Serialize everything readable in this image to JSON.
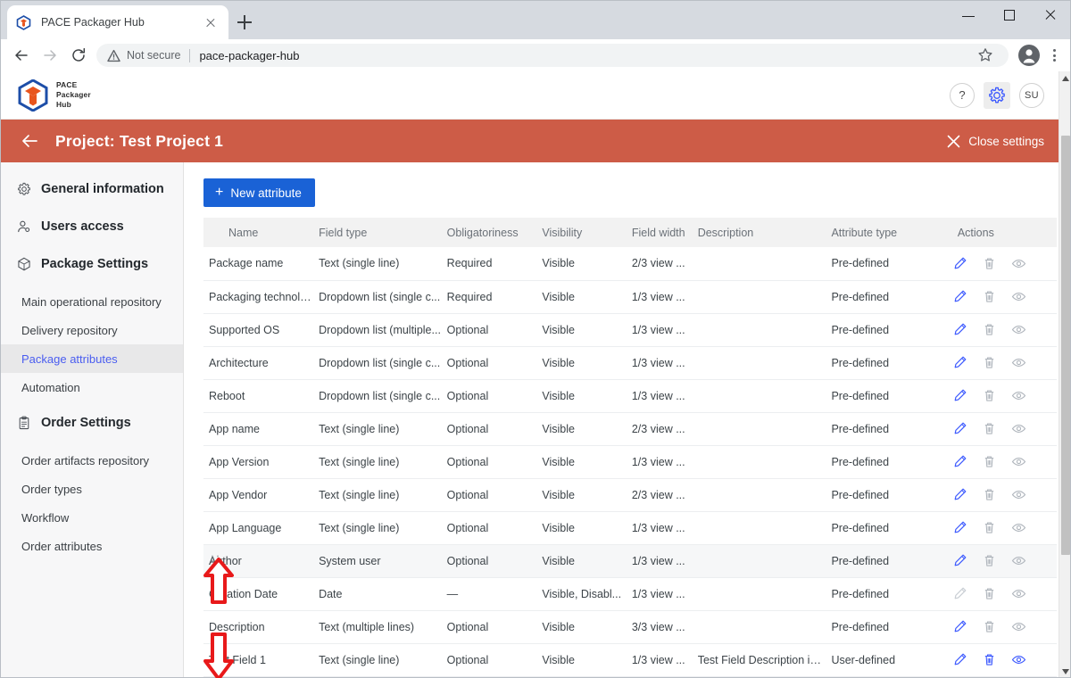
{
  "browser": {
    "tab": {
      "title": "PACE Packager Hub",
      "favicon_icon": "pace-cube-icon",
      "close_icon": "close-icon"
    },
    "new_tab_icon": "plus-icon",
    "window_controls": {
      "minimize": "minimize-icon",
      "maximize": "maximize-icon",
      "close": "close-icon"
    },
    "nav": {
      "back_icon": "back-arrow-icon",
      "forward_icon": "forward-arrow-icon",
      "reload_icon": "reload-icon"
    },
    "omnibox": {
      "warning_icon": "warning-triangle-icon",
      "security_label": "Not secure",
      "url": "pace-packager-hub",
      "bookmark_icon": "star-icon"
    },
    "profile_icon": "profile-avatar-icon",
    "menu_icon": "kebab-menu-icon"
  },
  "appbar": {
    "logo_icon": "pace-cube-logo-icon",
    "logo_lines": [
      "PACE",
      "Packager",
      "Hub"
    ],
    "help_label": "?",
    "help_icon": "help-icon",
    "settings_icon": "gear-icon",
    "user_initials": "SU"
  },
  "projectbar": {
    "back_icon": "back-arrow-icon",
    "title": "Project: Test Project 1",
    "close_icon": "close-icon",
    "close_label": "Close settings",
    "background_color": "#cd5c47"
  },
  "sidebar": {
    "groups": [
      {
        "icon": "gear-icon",
        "label": "General information",
        "items": []
      },
      {
        "icon": "user-access-icon",
        "label": "Users access",
        "items": []
      },
      {
        "icon": "package-cube-icon",
        "label": "Package Settings",
        "items": [
          {
            "label": "Main operational repository",
            "selected": false
          },
          {
            "label": "Delivery repository",
            "selected": false
          },
          {
            "label": "Package attributes",
            "selected": true
          },
          {
            "label": "Automation",
            "selected": false
          }
        ]
      },
      {
        "icon": "clipboard-icon",
        "label": "Order Settings",
        "items": [
          {
            "label": "Order artifacts repository",
            "selected": false
          },
          {
            "label": "Order types",
            "selected": false
          },
          {
            "label": "Workflow",
            "selected": false
          },
          {
            "label": "Order attributes",
            "selected": false
          }
        ]
      }
    ],
    "selected_color": "#4a5df0"
  },
  "content": {
    "new_attribute_button": {
      "label": "New attribute",
      "icon": "plus-icon",
      "color": "#1a62d6"
    },
    "table": {
      "columns": [
        "Name",
        "Field type",
        "Obligatoriness",
        "Visibility",
        "Field width",
        "Description",
        "Attribute type",
        "Actions"
      ],
      "rows": [
        {
          "name": "Package name",
          "field_type": "Text (single line)",
          "obligatoriness": "Required",
          "visibility": "Visible",
          "field_width": "2/3 view ...",
          "description": "",
          "attribute_type": "Pre-defined",
          "edit_enabled": true,
          "delete_enabled": false,
          "view_enabled": false,
          "highlighted": false,
          "draggable": false
        },
        {
          "name": "Packaging technolo...",
          "field_type": "Dropdown list (single c...",
          "obligatoriness": "Required",
          "visibility": "Visible",
          "field_width": "1/3 view ...",
          "description": "",
          "attribute_type": "Pre-defined",
          "edit_enabled": true,
          "delete_enabled": false,
          "view_enabled": false,
          "highlighted": false,
          "draggable": false
        },
        {
          "name": "Supported OS",
          "field_type": "Dropdown list (multiple...",
          "obligatoriness": "Optional",
          "visibility": "Visible",
          "field_width": "1/3 view ...",
          "description": "",
          "attribute_type": "Pre-defined",
          "edit_enabled": true,
          "delete_enabled": false,
          "view_enabled": false,
          "highlighted": false,
          "draggable": false
        },
        {
          "name": "Architecture",
          "field_type": "Dropdown list (single c...",
          "obligatoriness": "Optional",
          "visibility": "Visible",
          "field_width": "1/3 view ...",
          "description": "",
          "attribute_type": "Pre-defined",
          "edit_enabled": true,
          "delete_enabled": false,
          "view_enabled": false,
          "highlighted": false,
          "draggable": false
        },
        {
          "name": "Reboot",
          "field_type": "Dropdown list (single c...",
          "obligatoriness": "Optional",
          "visibility": "Visible",
          "field_width": "1/3 view ...",
          "description": "",
          "attribute_type": "Pre-defined",
          "edit_enabled": true,
          "delete_enabled": false,
          "view_enabled": false,
          "highlighted": false,
          "draggable": false
        },
        {
          "name": "App name",
          "field_type": "Text (single line)",
          "obligatoriness": "Optional",
          "visibility": "Visible",
          "field_width": "2/3 view ...",
          "description": "",
          "attribute_type": "Pre-defined",
          "edit_enabled": true,
          "delete_enabled": false,
          "view_enabled": false,
          "highlighted": false,
          "draggable": false
        },
        {
          "name": "App Version",
          "field_type": "Text (single line)",
          "obligatoriness": "Optional",
          "visibility": "Visible",
          "field_width": "1/3 view ...",
          "description": "",
          "attribute_type": "Pre-defined",
          "edit_enabled": true,
          "delete_enabled": false,
          "view_enabled": false,
          "highlighted": false,
          "draggable": false
        },
        {
          "name": "App Vendor",
          "field_type": "Text (single line)",
          "obligatoriness": "Optional",
          "visibility": "Visible",
          "field_width": "2/3 view ...",
          "description": "",
          "attribute_type": "Pre-defined",
          "edit_enabled": true,
          "delete_enabled": false,
          "view_enabled": false,
          "highlighted": false,
          "draggable": false
        },
        {
          "name": "App Language",
          "field_type": "Text (single line)",
          "obligatoriness": "Optional",
          "visibility": "Visible",
          "field_width": "1/3 view ...",
          "description": "",
          "attribute_type": "Pre-defined",
          "edit_enabled": true,
          "delete_enabled": false,
          "view_enabled": false,
          "highlighted": false,
          "draggable": false
        },
        {
          "name": "Author",
          "field_type": "System user",
          "obligatoriness": "Optional",
          "visibility": "Visible",
          "field_width": "1/3 view ...",
          "description": "",
          "attribute_type": "Pre-defined",
          "edit_enabled": true,
          "delete_enabled": false,
          "view_enabled": false,
          "highlighted": true,
          "draggable": true
        },
        {
          "name": "Creation Date",
          "field_type": "Date",
          "obligatoriness": "—",
          "visibility": "Visible, Disabl...",
          "field_width": "1/3 view ...",
          "description": "",
          "attribute_type": "Pre-defined",
          "edit_enabled": false,
          "delete_enabled": false,
          "view_enabled": false,
          "highlighted": false,
          "draggable": false
        },
        {
          "name": "Description",
          "field_type": "Text (multiple lines)",
          "obligatoriness": "Optional",
          "visibility": "Visible",
          "field_width": "3/3 view ...",
          "description": "",
          "attribute_type": "Pre-defined",
          "edit_enabled": true,
          "delete_enabled": false,
          "view_enabled": false,
          "highlighted": false,
          "draggable": false
        },
        {
          "name": "Test Field 1",
          "field_type": "Text (single line)",
          "obligatoriness": "Optional",
          "visibility": "Visible",
          "field_width": "1/3 view ...",
          "description": "Test Field Description in T...",
          "attribute_type": "User-defined",
          "edit_enabled": true,
          "delete_enabled": true,
          "view_enabled": true,
          "highlighted": false,
          "draggable": false
        }
      ],
      "action_icons": {
        "edit": "pencil-icon",
        "delete": "trash-icon",
        "view": "eye-icon"
      }
    }
  },
  "annotations": {
    "arrow_color": "#e8191a",
    "items": [
      {
        "name": "drag-up-arrow",
        "direction": "up"
      },
      {
        "name": "drag-down-arrow",
        "direction": "down"
      }
    ]
  },
  "scrollbar": {
    "up_icon": "scroll-up-icon",
    "down_icon": "scroll-down-icon"
  }
}
